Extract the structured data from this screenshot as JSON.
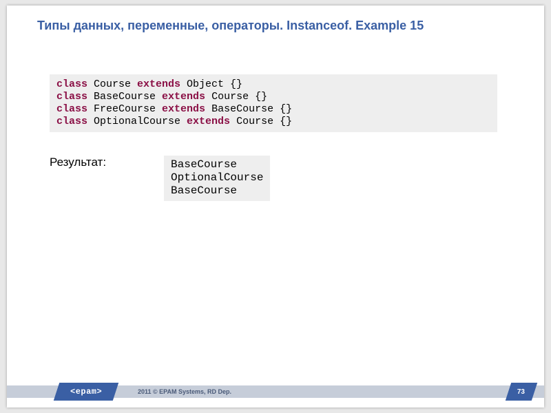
{
  "title": "Типы данных, переменные, операторы. Instanceof. Example 15",
  "code": {
    "lines": [
      {
        "tokens": [
          {
            "t": "class",
            "kw": true
          },
          {
            "t": " Course ",
            "kw": false
          },
          {
            "t": "extends",
            "kw": true
          },
          {
            "t": " Object {}",
            "kw": false
          }
        ]
      },
      {
        "tokens": [
          {
            "t": "class",
            "kw": true
          },
          {
            "t": " BaseCourse ",
            "kw": false
          },
          {
            "t": "extends",
            "kw": true
          },
          {
            "t": " Course {}",
            "kw": false
          }
        ]
      },
      {
        "tokens": [
          {
            "t": "class",
            "kw": true
          },
          {
            "t": " FreeCourse ",
            "kw": false
          },
          {
            "t": "extends",
            "kw": true
          },
          {
            "t": " BaseCourse {}",
            "kw": false
          }
        ]
      },
      {
        "tokens": [
          {
            "t": "class",
            "kw": true
          },
          {
            "t": " OptionalCourse ",
            "kw": false
          },
          {
            "t": "extends",
            "kw": true
          },
          {
            "t": " Course {}",
            "kw": false
          }
        ]
      }
    ]
  },
  "result_label": "Результат:",
  "output": "BaseCourse\nOptionalCourse\nBaseCourse",
  "footer": {
    "logo_text": "<epam>",
    "copyright": "2011 © EPAM Systems, RD Dep.",
    "page": "73"
  }
}
